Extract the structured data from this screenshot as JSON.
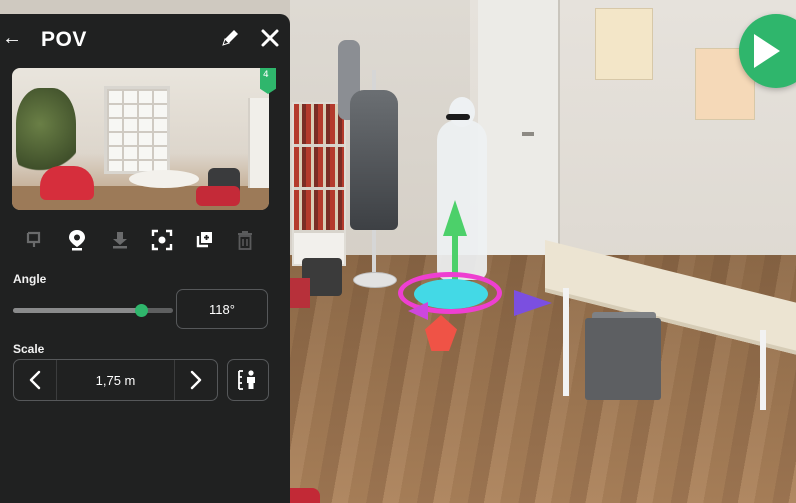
{
  "panel": {
    "title": "POV",
    "back_icon": "arrow-left-icon",
    "edit_icon": "pencil-icon",
    "close_icon": "close-icon",
    "thumbnail_marker": "4"
  },
  "toolbar": {
    "items": [
      {
        "icon": "flag-marker-icon",
        "state": "disabled"
      },
      {
        "icon": "map-pin-icon",
        "state": "enabled"
      },
      {
        "icon": "download-icon",
        "state": "disabled"
      },
      {
        "icon": "focus-frame-icon",
        "state": "enabled"
      },
      {
        "icon": "duplicate-icon",
        "state": "enabled"
      },
      {
        "icon": "trash-icon",
        "state": "disabled"
      }
    ]
  },
  "angle": {
    "label": "Angle",
    "value": "118°",
    "slider_fraction": 0.8
  },
  "scale": {
    "label": "Scale",
    "value": "1,75 m",
    "prev_icon": "chevron-left-icon",
    "next_icon": "chevron-right-icon",
    "person_icon": "person-height-icon"
  },
  "viewer": {
    "play_icon": "play-icon",
    "accent_color": "#2fb66c",
    "panel_color": "#202121"
  }
}
